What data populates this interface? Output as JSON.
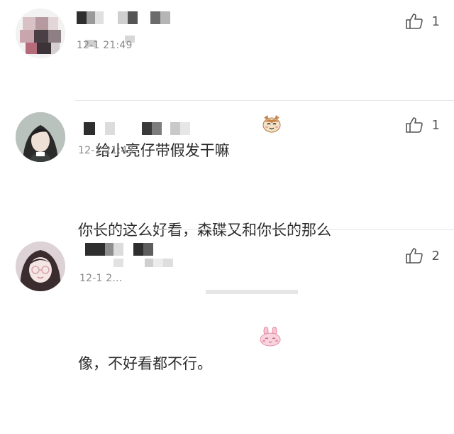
{
  "comments": [
    {
      "username_obscured": true,
      "timestamp": "12-1 21:49",
      "text": "给小亮仔带假发干嘛",
      "emoji": "cat-face-emoji",
      "likes": "1"
    },
    {
      "username_obscured": true,
      "timestamp": "12-1 21:43",
      "text_line1": "你长的这么好看，森碟又和你长的那么",
      "text_line2": "像，不好看都不行。",
      "emoji": "pink-bunny-emoji",
      "likes": "1"
    },
    {
      "username_obscured": true,
      "timestamp": "12-1 2...",
      "likes": "2"
    }
  ],
  "colors": {
    "text": "#2b2b2b",
    "timestamp": "#8a8a8a",
    "divider": "#e8e8e8",
    "like_icon": "#555555"
  }
}
